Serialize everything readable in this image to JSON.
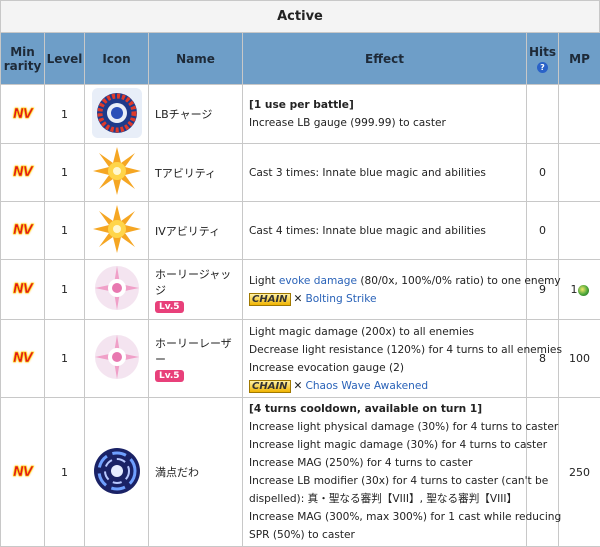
{
  "caption": "Active",
  "headers": {
    "rarity": [
      "Min",
      "rarity"
    ],
    "level": "Level",
    "icon": "Icon",
    "name": "Name",
    "effect": "Effect",
    "hits": "Hits",
    "hits_help": "?",
    "mp": "MP"
  },
  "rows": [
    {
      "rarity": "NV",
      "level": "1",
      "icon": "lb-gauge-icon",
      "name": "LBチャージ",
      "effect_lines": [
        "[1 use per battle]",
        "Increase LB gauge (999.99) to caster"
      ],
      "hits": "",
      "mp": ""
    },
    {
      "rarity": "NV",
      "level": "1",
      "icon": "starburst-icon",
      "name": "Tアビリティ",
      "effect_lines": [
        "Cast 3 times: Innate blue magic and abilities"
      ],
      "hits": "0",
      "mp": ""
    },
    {
      "rarity": "NV",
      "level": "1",
      "icon": "starburst-icon",
      "name": "IVアビリティ",
      "effect_lines": [
        "Cast 4 times: Innate blue magic and abilities"
      ],
      "hits": "0",
      "mp": ""
    },
    {
      "rarity": "NV",
      "level": "1",
      "icon": "holy-burst-icon",
      "name": "ホーリージャッジ",
      "badge": "Lv.5",
      "effect_pre": "Light ",
      "effect_link": "evoke damage",
      "effect_post": " (80/0x, 100%/0% ratio) to one enemy",
      "chain_label": "CHAIN",
      "chain_x": "✕",
      "chain_link": "Bolting Strike",
      "hits": "9",
      "mp": "1"
    },
    {
      "rarity": "NV",
      "level": "1",
      "icon": "holy-burst-icon",
      "name": "ホーリーレーザー",
      "badge": "Lv.5",
      "effect_lines": [
        "Light magic damage (200x) to all enemies",
        "Decrease light resistance (120%) for 4 turns to all enemies",
        "Increase evocation gauge (2)"
      ],
      "chain_label": "CHAIN",
      "chain_x": "✕",
      "chain_link": "Chaos Wave Awakened",
      "hits": "8",
      "mp": "100"
    },
    {
      "rarity": "NV",
      "level": "1",
      "icon": "vortex-icon",
      "name": "満点だわ",
      "effect_lines": [
        "[4 turns cooldown, available on turn 1]",
        "Increase light physical damage (30%) for 4 turns to caster",
        "Increase light magic damage (30%) for 4 turns to caster",
        "Increase MAG (250%) for 4 turns to caster",
        "Increase LB modifier (30x) for 4 turns to caster (can't be",
        "dispelled): 真・聖なる審判【VIII】, 聖なる審判【VIII】",
        "Increase MAG (300%, max 300%) for 1 cast while reducing",
        "SPR (50%) to caster"
      ],
      "hits": "",
      "mp": "250"
    }
  ],
  "colors": {
    "header_bg": "#6e9ec8",
    "link": "#2962b8",
    "badge": "#e8407a",
    "nv": "#e0181c"
  }
}
